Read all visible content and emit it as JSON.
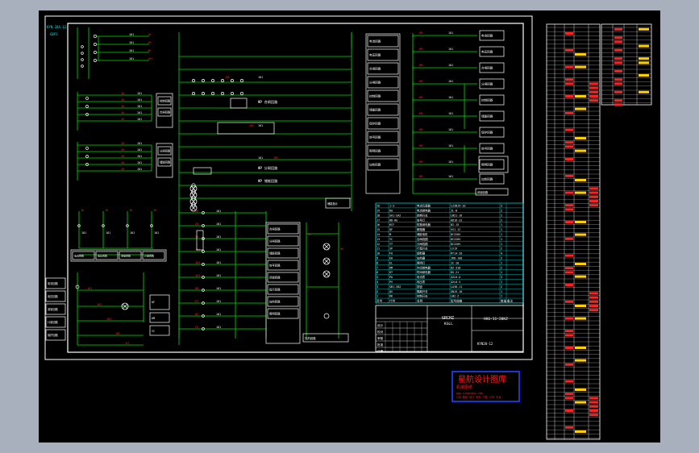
{
  "colors": {
    "background": "#a7b0bc",
    "canvas": "#000000",
    "frame": "#ffffff",
    "wire": "#00e000",
    "tag": "#ff2020",
    "text": "#ffffff",
    "table": "#00e5e5",
    "stamp_border": "#2244ff",
    "stamp_text": "#ff2020"
  },
  "drawing": {
    "top_left_note": "KYN 28A-12",
    "top_left_code": "GBFG",
    "product_code": "KYN28-12",
    "title_name": "GRCHZ",
    "title_sub": "KGLL",
    "drawing_number": "HXG-11-20KZ"
  },
  "function_boxes": [
    "控制回路",
    "合闸回路",
    "分闸回路",
    "储能回路",
    "信号回路",
    "保护跳闸",
    "事故信号",
    "预告信号",
    "合闸指示",
    "分闸指示",
    "储能指示",
    "加热回路",
    "照明回路"
  ],
  "right_boxes": [
    "电流回路",
    "电压回路",
    "合闸回路",
    "分闸回路",
    "控制回路",
    "储能回路",
    "保护回路",
    "信号回路",
    "照明回路",
    "加热回路"
  ],
  "mid_boxes": [
    "合闸回路",
    "分闸回路",
    "储能回路",
    "信号回路",
    "闭锁回路",
    "指示回路",
    "加热回路",
    "照明回路"
  ],
  "left_boxes": [
    "电流回路",
    "电压回路",
    "测量回路",
    "计量回路",
    "保护回路"
  ],
  "components": [
    {
      "no": "20",
      "code": "1~3",
      "name": "电流互感器",
      "spec": "LZZBJ9-10",
      "qty": "3"
    },
    {
      "no": "19",
      "code": "KA",
      "name": "电流继电器",
      "spec": "JL-8",
      "qty": "2"
    },
    {
      "no": "18",
      "code": "SA1-SA2",
      "name": "转换开关",
      "spec": "LW21-16",
      "qty": "2"
    },
    {
      "no": "17",
      "code": "HD-HG",
      "name": "信号灯",
      "spec": "AD16-22",
      "qty": "2"
    },
    {
      "no": "16",
      "code": "KCF",
      "name": "防跳继电器",
      "spec": "DZ-15",
      "qty": "1"
    },
    {
      "no": "15",
      "code": "QF",
      "name": "断路器",
      "spec": "VS1-12",
      "qty": "1"
    },
    {
      "no": "14",
      "code": "M",
      "name": "储能电机",
      "spec": "DC220V",
      "qty": "1"
    },
    {
      "no": "13",
      "code": "YC",
      "name": "合闸线圈",
      "spec": "DC220V",
      "qty": "1"
    },
    {
      "no": "12",
      "code": "YT",
      "name": "分闸线圈",
      "spec": "DC220V",
      "qty": "1"
    },
    {
      "no": "11",
      "code": "SP",
      "name": "行程开关",
      "spec": "LX19",
      "qty": "2"
    },
    {
      "no": "10",
      "code": "FU",
      "name": "熔断器",
      "spec": "RT14-20",
      "qty": "4"
    },
    {
      "no": "9",
      "code": "EH",
      "name": "加热器",
      "spec": "JRD-100",
      "qty": "2"
    },
    {
      "no": "8",
      "code": "EL",
      "name": "照明灯",
      "spec": "JC-10",
      "qty": "1"
    },
    {
      "no": "7",
      "code": "KM",
      "name": "中间继电器",
      "spec": "DZ-31B",
      "qty": "2"
    },
    {
      "no": "6",
      "code": "KT",
      "name": "时间继电器",
      "spec": "DS-21",
      "qty": "1"
    },
    {
      "no": "5",
      "code": "PA",
      "name": "电流表",
      "spec": "42L6-A",
      "qty": "3"
    },
    {
      "no": "4",
      "code": "PV",
      "name": "电压表",
      "spec": "42L6-V",
      "qty": "1"
    },
    {
      "no": "3",
      "code": "SB1-SB2",
      "name": "按钮",
      "spec": "LA38-11",
      "qty": "2"
    },
    {
      "no": "2",
      "code": "QS",
      "name": "隔离开关",
      "spec": "GN19-10",
      "qty": "1"
    },
    {
      "no": "1",
      "code": "KK",
      "name": "控制开关",
      "spec": "LW2-Z",
      "qty": "1"
    }
  ],
  "table_header": [
    "序号",
    "代号",
    "名称",
    "型号规格",
    "数量",
    "备注"
  ],
  "title_block_rows": [
    "设计",
    "校对",
    "审核",
    "批准",
    "日期"
  ],
  "stamp": {
    "title": "星航设计图库",
    "subtitle": "机械图纸",
    "line1": "www.xinghang.com",
    "line2": "CAD 图纸 设计 资料 下载 分享 平台"
  },
  "wire_tags": [
    "1H",
    "2H",
    "3H",
    "101",
    "102",
    "103",
    "KM",
    "KT",
    "QF",
    "FU",
    "SB",
    "HD",
    "HG",
    "YC",
    "YT"
  ]
}
